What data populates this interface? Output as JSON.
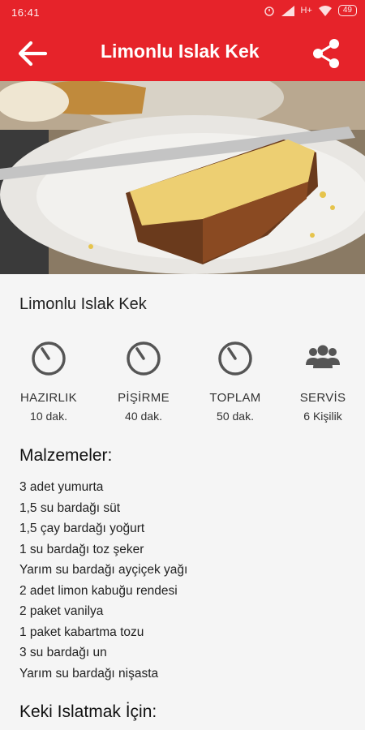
{
  "status": {
    "time": "16:41",
    "network": "H+",
    "battery": "49"
  },
  "appbar": {
    "title": "Limonlu Islak Kek"
  },
  "recipe": {
    "title": "Limonlu Islak Kek",
    "stats": [
      {
        "label": "HAZIRLIK",
        "value": "10 dak.",
        "icon": "clock-icon"
      },
      {
        "label": "PİŞİRME",
        "value": "40 dak.",
        "icon": "clock-icon"
      },
      {
        "label": "TOPLAM",
        "value": "50 dak.",
        "icon": "clock-icon"
      },
      {
        "label": "SERVİS",
        "value": "6 Kişilik",
        "icon": "people-icon"
      }
    ],
    "ingredients_heading": "Malzemeler:",
    "ingredients": [
      "3 adet yumurta",
      "1,5 su bardağı süt",
      "1,5 çay bardağı yoğurt",
      "1 su bardağı toz şeker",
      "Yarım su bardağı ayçiçek yağı",
      "2 adet limon kabuğu rendesi",
      "2 paket vanilya",
      "1 paket kabartma tozu",
      "3 su bardağı un",
      "Yarım su bardağı nişasta"
    ],
    "soak_heading": "Keki Islatmak İçin:"
  }
}
